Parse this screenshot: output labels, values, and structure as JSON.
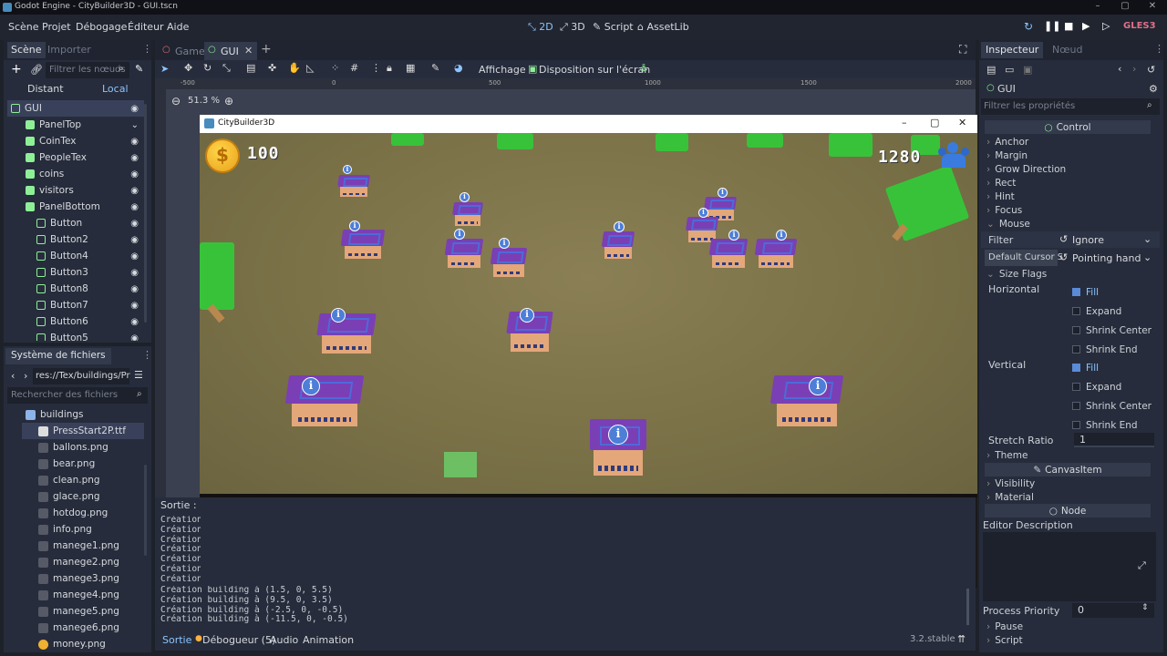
{
  "window": {
    "title": "Godot Engine - CityBuilder3D - GUI.tscn"
  },
  "menubar": {
    "menus": [
      "Scène",
      "Projet",
      "Débogage",
      "Éditeur",
      "Aide"
    ],
    "modes": [
      "2D",
      "3D",
      "Script",
      "AssetLib"
    ],
    "renderer": "GLES3"
  },
  "scene_dock": {
    "tabs": [
      "Scène",
      "Importer"
    ],
    "filter_placeholder": "Filtrer les nœuds",
    "toggle": [
      "Distant",
      "Local"
    ],
    "tree": [
      {
        "name": "GUI",
        "color": "#8eef97"
      },
      {
        "name": "PanelTop",
        "color": "#8eef97"
      },
      {
        "name": "CoinTex",
        "color": "#8eef97"
      },
      {
        "name": "PeopleTex",
        "color": "#8eef97"
      },
      {
        "name": "coins",
        "color": "#8eef97"
      },
      {
        "name": "visitors",
        "color": "#8eef97"
      },
      {
        "name": "PanelBottom",
        "color": "#8eef97"
      },
      {
        "name": "Button",
        "color": "#8eef97"
      },
      {
        "name": "Button2",
        "color": "#8eef97"
      },
      {
        "name": "Button4",
        "color": "#8eef97"
      },
      {
        "name": "Button3",
        "color": "#8eef97"
      },
      {
        "name": "Button8",
        "color": "#8eef97"
      },
      {
        "name": "Button7",
        "color": "#8eef97"
      },
      {
        "name": "Button6",
        "color": "#8eef97"
      },
      {
        "name": "Button5",
        "color": "#8eef97"
      }
    ]
  },
  "fs_dock": {
    "title": "Système de fichiers",
    "path": "res://Tex/buildings/Pr",
    "search_placeholder": "Rechercher des fichiers",
    "items": [
      "buildings",
      "PressStart2P.ttf",
      "ballons.png",
      "bear.png",
      "clean.png",
      "glace.png",
      "hotdog.png",
      "info.png",
      "manege1.png",
      "manege2.png",
      "manege3.png",
      "manege4.png",
      "manege5.png",
      "manege6.png",
      "money.png"
    ]
  },
  "editor": {
    "tabs": [
      "Game",
      "GUI"
    ],
    "toolbar": {
      "view": "Affichage",
      "layout": "Disposition sur l'écran"
    },
    "zoom": "51.3 %",
    "ruler": [
      "-500",
      "0",
      "500",
      "1000",
      "1500",
      "2000"
    ]
  },
  "game": {
    "title": "CityBuilder3D",
    "coins": "100",
    "visitors": "1280"
  },
  "output": {
    "label": "Sortie :",
    "lines": [
      "Création",
      "Création",
      "Création",
      "Création",
      "Création",
      "Création",
      "Création",
      "Création building à (1.5, 0, 5.5)",
      "Création building à (9.5, 0, 3.5)",
      "Création building à (-2.5, 0, -0.5)",
      "Création building à (-11.5, 0, -0.5)"
    ],
    "tabs": [
      "Sortie",
      "Débogueur (5)",
      "Audio",
      "Animation"
    ],
    "version": "3.2.stable"
  },
  "inspector": {
    "tabs": [
      "Inspecteur",
      "Nœud"
    ],
    "node": "GUI",
    "filter_placeholder": "Filtrer les propriétés",
    "control_section": "Control",
    "groups": [
      "Anchor",
      "Margin",
      "Grow Direction",
      "Rect",
      "Hint",
      "Focus",
      "Mouse"
    ],
    "filter_label": "Filter",
    "filter_value": "Ignore",
    "cursor_label": "Default Cursor S",
    "cursor_value": "Pointing hand",
    "size_flags": "Size Flags",
    "horizontal": "Horizontal",
    "vertical": "Vertical",
    "flags": [
      "Fill",
      "Expand",
      "Shrink Center",
      "Shrink End"
    ],
    "stretch_label": "Stretch Ratio",
    "stretch_value": "1",
    "theme": "Theme",
    "canvas_section": "CanvasItem",
    "visibility": "Visibility",
    "material": "Material",
    "node_section": "Node",
    "editor_description": "Editor Description",
    "process_priority": "Process Priority",
    "process_value": "0",
    "pause": "Pause",
    "script": "Script"
  }
}
